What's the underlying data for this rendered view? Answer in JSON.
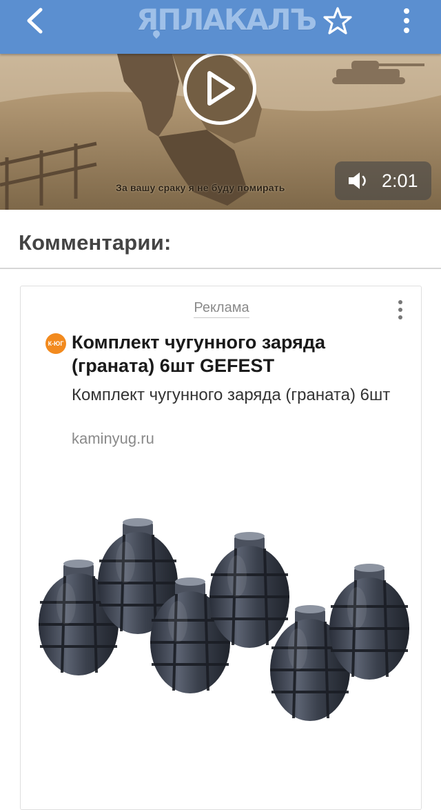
{
  "app": {
    "logo_text": "ЯПЛАКАЛЪ",
    "brand_color": "#5b8fd0",
    "icons": [
      "chevron-left-icon",
      "star-outline-icon",
      "more-vertical-icon"
    ]
  },
  "video": {
    "subtitle": "За вашу сраку я не буду помирать",
    "duration": "2:01",
    "icons": [
      "play-icon",
      "speaker-icon"
    ]
  },
  "comments": {
    "title": "Комментарии:"
  },
  "ad": {
    "label": "Реклама",
    "favicon_text": "К-ЮГ",
    "title": "Комплект чугунного заряда (граната) 6шт GEFEST",
    "description": "Комплект чугунного заряда (граната) 6шт",
    "domain": "kaminyug.ru",
    "accent_color": "#f28a1e"
  }
}
